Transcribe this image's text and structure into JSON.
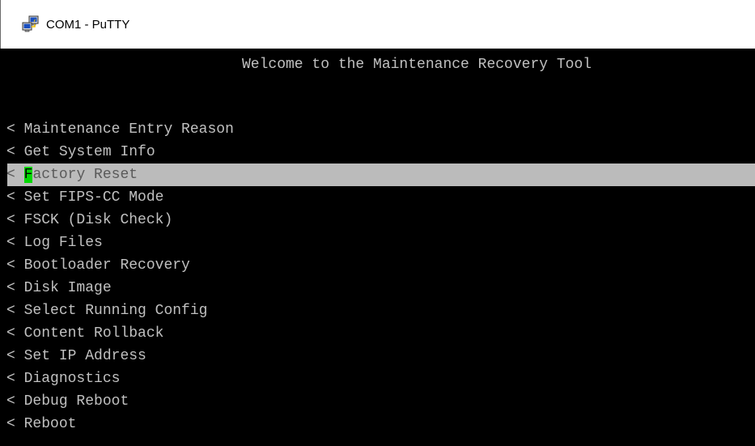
{
  "window": {
    "title": "COM1 - PuTTY",
    "icon": "putty-icon"
  },
  "terminal": {
    "welcome": "Welcome to the Maintenance Recovery Tool",
    "prefix": "<",
    "menu": [
      {
        "label": "Maintenance Entry Reason",
        "selected": false
      },
      {
        "label": "Get System Info",
        "selected": false
      },
      {
        "label": "Factory Reset",
        "selected": true,
        "cursor_letter": "F",
        "rest": "actory Reset"
      },
      {
        "label": "Set FIPS-CC Mode",
        "selected": false
      },
      {
        "label": "FSCK (Disk Check)",
        "selected": false
      },
      {
        "label": "Log Files",
        "selected": false
      },
      {
        "label": "Bootloader Recovery",
        "selected": false
      },
      {
        "label": "Disk Image",
        "selected": false
      },
      {
        "label": "Select Running Config",
        "selected": false
      },
      {
        "label": "Content Rollback",
        "selected": false
      },
      {
        "label": "Set IP Address",
        "selected": false
      },
      {
        "label": "Diagnostics",
        "selected": false
      },
      {
        "label": "Debug Reboot",
        "selected": false
      },
      {
        "label": "Reboot",
        "selected": false
      }
    ]
  },
  "colors": {
    "terminal_bg": "#000000",
    "terminal_fg": "#c0c0c0",
    "selection_bg": "#bbbbbb",
    "cursor": "#00d800"
  }
}
